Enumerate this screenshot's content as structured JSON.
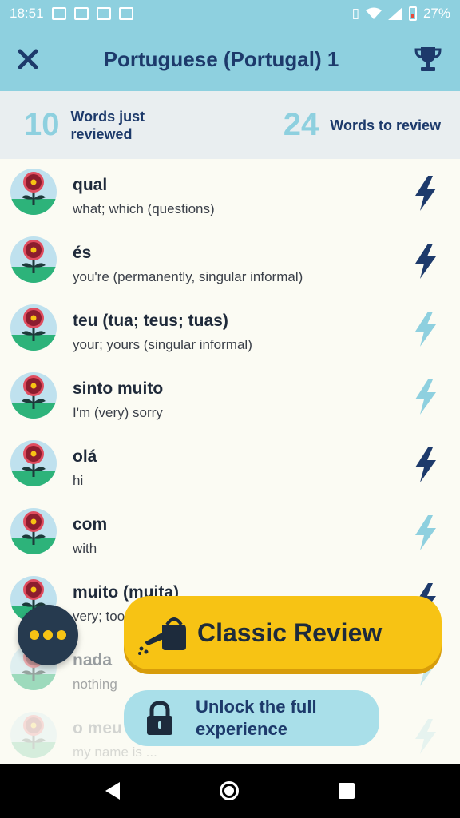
{
  "status_bar": {
    "time": "18:51",
    "battery": "27%",
    "icons": [
      "image-icon",
      "gmail-icon",
      "gmail-icon",
      "translate-icon",
      "vibrate-icon",
      "wifi-icon",
      "signal-icon",
      "battery-icon"
    ]
  },
  "header": {
    "title": "Portuguese (Portugal) 1",
    "close_icon": "close-icon",
    "trophy_icon": "trophy-icon"
  },
  "stats": {
    "reviewed_count": "10",
    "reviewed_label": "Words just reviewed",
    "to_review_count": "24",
    "to_review_label": "Words to review"
  },
  "words": [
    {
      "word": "qual",
      "definition": "what; which (questions)",
      "bolt": "dark"
    },
    {
      "word": "és",
      "definition": "you're (permanently, singular informal)",
      "bolt": "dark"
    },
    {
      "word": "teu (tua; teus; tuas)",
      "definition": "your; yours (singular informal)",
      "bolt": "light"
    },
    {
      "word": "sinto muito",
      "definition": "I'm (very) sorry",
      "bolt": "light"
    },
    {
      "word": "olá",
      "definition": "hi",
      "bolt": "dark"
    },
    {
      "word": "com",
      "definition": "with",
      "bolt": "light"
    },
    {
      "word": "muito (muita)",
      "definition": "very; too",
      "bolt": "dark"
    },
    {
      "word": "nada",
      "definition": "nothing",
      "bolt": "light"
    },
    {
      "word": "o meu",
      "definition": "my name is ...",
      "bolt": "light"
    }
  ],
  "actions": {
    "classic_review": "Classic Review",
    "unlock": "Unlock the full experience"
  },
  "colors": {
    "header_bg": "#8ed0df",
    "title_text": "#1d3a6b",
    "bolt_dark": "#1d3a6b",
    "bolt_light": "#8ed0df",
    "classic_bg": "#f7c314",
    "fab_bg": "#263a4f"
  }
}
